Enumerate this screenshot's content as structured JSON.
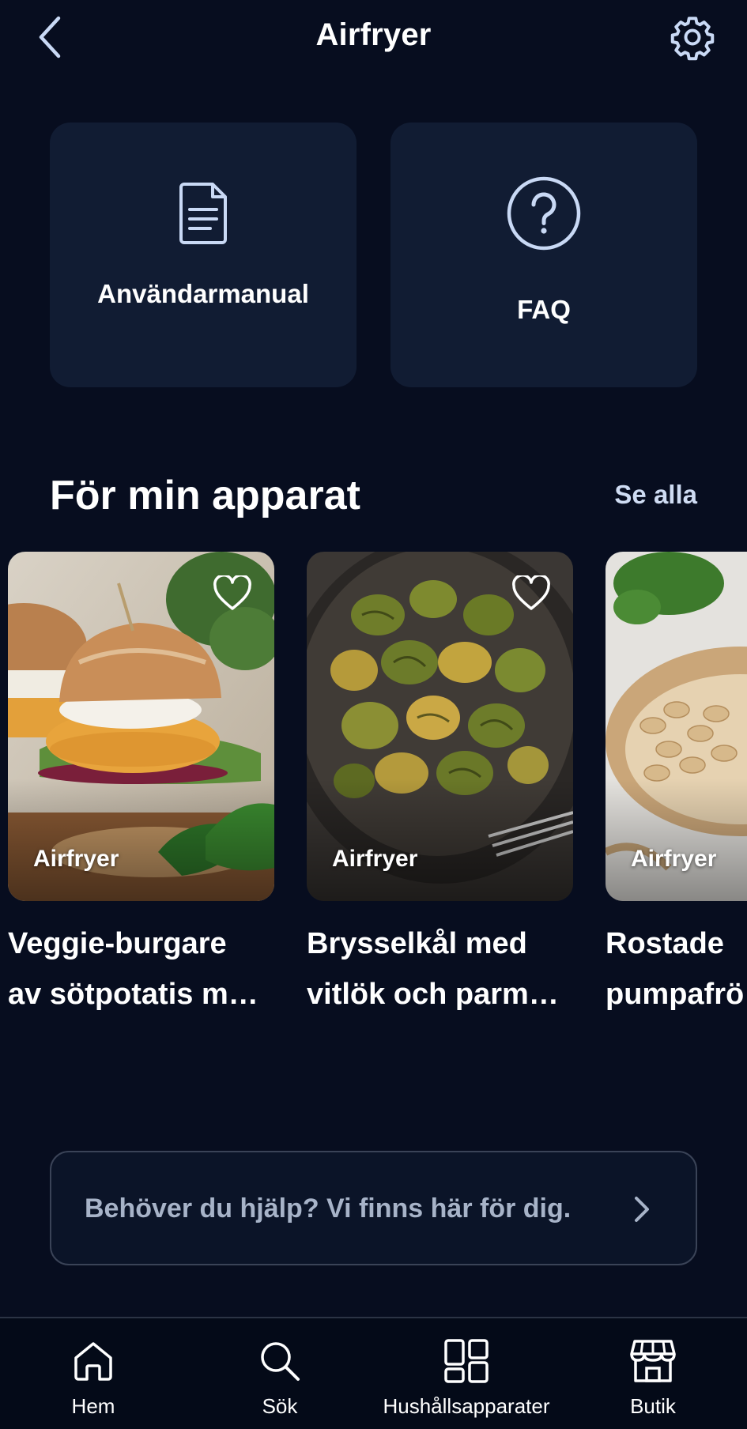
{
  "header": {
    "title": "Airfryer",
    "back_icon": "chevron-left-icon",
    "settings_icon": "gear-icon"
  },
  "tiles": [
    {
      "label": "Användarmanual",
      "icon": "document-icon"
    },
    {
      "label": "FAQ",
      "icon": "question-circle-icon"
    }
  ],
  "section": {
    "title": "För min apparat",
    "see_all": "Se alla"
  },
  "cards": [
    {
      "tag": "Airfryer",
      "title_line1": "Veggie-burgare",
      "title_line2": "av sötpotatis m…"
    },
    {
      "tag": "Airfryer",
      "title_line1": "Brysselkål med",
      "title_line2": "vitlök och parm…"
    },
    {
      "tag": "Airfryer",
      "title_line1": "Rostade",
      "title_line2": "pumpafrö"
    }
  ],
  "help": {
    "text": "Behöver du hjälp? Vi finns här för dig."
  },
  "nav": [
    {
      "label": "Hem",
      "icon": "home-icon"
    },
    {
      "label": "Sök",
      "icon": "search-icon"
    },
    {
      "label": "Hushållsapparater",
      "icon": "appliances-grid-icon"
    },
    {
      "label": "Butik",
      "icon": "store-icon"
    }
  ],
  "colors": {
    "background": "#070d1f",
    "tile": "#111c33",
    "accent_text": "#cfdcf3",
    "icon_blue": "#c9d9f5"
  }
}
